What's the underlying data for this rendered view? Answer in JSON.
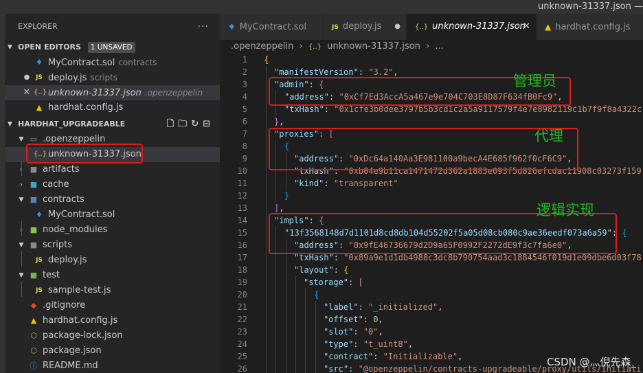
{
  "window": {
    "title": "unknown-31337.json —"
  },
  "sidebar": {
    "title": "EXPLORER",
    "more": "···",
    "open_editors": {
      "label": "OPEN EDITORS",
      "badge": "1 UNSAVED",
      "items": [
        {
          "name": "MyContract.sol",
          "desc": "contracts"
        },
        {
          "name": "deploy.js",
          "desc": "scripts"
        },
        {
          "name": "unknown-31337.json",
          "desc": ".openzeppelin"
        },
        {
          "name": "hardhat.config.js",
          "desc": ""
        }
      ]
    },
    "project": {
      "label": "HARDHAT_UPGRADEABLE",
      "items": [
        {
          "name": ".openzeppelin"
        },
        {
          "name": "unknown-31337.json"
        },
        {
          "name": "artifacts"
        },
        {
          "name": "cache"
        },
        {
          "name": "contracts"
        },
        {
          "name": "MyContract.sol"
        },
        {
          "name": "node_modules"
        },
        {
          "name": "scripts"
        },
        {
          "name": "deploy.js"
        },
        {
          "name": "test"
        },
        {
          "name": "sample-test.js"
        },
        {
          "name": ".gitignore"
        },
        {
          "name": "hardhat.config.js"
        },
        {
          "name": "package-lock.json"
        },
        {
          "name": "package.json"
        },
        {
          "name": "README.md"
        }
      ]
    }
  },
  "tabs": [
    {
      "label": "MyContract.sol"
    },
    {
      "label": "deploy.js"
    },
    {
      "label": "unknown-31337.json"
    },
    {
      "label": "hardhat.config.js"
    }
  ],
  "breadcrumb": {
    "folder": ".openzeppelin",
    "file": "unknown-31337.json",
    "more": "..."
  },
  "code": {
    "line_numbers": [
      "1",
      "2",
      "3",
      "4",
      "5",
      "6",
      "7",
      "8",
      "9",
      "10",
      "11",
      "12",
      "13",
      "14",
      "15",
      "16",
      "17",
      "18",
      "19",
      "20",
      "21",
      "22",
      "23",
      "24",
      "25",
      "26"
    ],
    "manifestVersion_key": "\"manifestVersion\"",
    "manifestVersion_val": "\"3.2\"",
    "admin_key": "\"admin\"",
    "address_key": "\"address\"",
    "admin_address": "\"0xCf7Ed3AccA5a467e9e704C703E8D87F634fB0Fc9\"",
    "txHash_key": "\"txHash\"",
    "admin_txhash": "\"0x1cfe3b0dee3797b5b3cd1c2a5a9117579f4e7e8982119c1b7f9f8a4322c",
    "proxies_key": "\"proxies\"",
    "proxy_address": "\"0xDc64a140Aa3E981100a9becA4E685f962f0cF6C9\"",
    "proxy_txhash": "\"0xb04e9b11ca1471472d362a1883e093f5d826efcdac11908c03273f159",
    "kind_key": "\"kind\"",
    "kind_val": "\"transparent\"",
    "impls_key": "\"impls\"",
    "impl_hash": "\"13f3568148d7d1101d8cd8db104d55202f5a05d08cb080c9ae36eedf073a6a59\"",
    "impl_address": "\"0x9fE46736679d2D9a65F0992F2272dE9f3c7fa6e0\"",
    "impl_txhash": "\"0x89a9e1d1db4988c3dc8b790754aad3c1884546f019d1e09dbe6d03f78",
    "layout_key": "\"layout\"",
    "storage_key": "\"storage\"",
    "label_key": "\"label\"",
    "label_val": "\"_initialized\"",
    "offset_key": "\"offset\"",
    "offset_val": "0",
    "slot_key": "\"slot\"",
    "slot_val": "\"0\"",
    "type_key": "\"type\"",
    "type_val": "\"t_uint8\"",
    "contract_key": "\"contract\"",
    "contract_val": "\"Initializable\"",
    "src_key": "\"src\"",
    "src_val": "\"@openzeppelin/contracts-upgradeable/proxy/utils/Initiali"
  },
  "annotations": {
    "admin": "管理员",
    "proxy": "代理",
    "impl": "逻辑实现"
  },
  "watermark": "CSDN @灬倪先森_",
  "colors": {
    "highlight": "#e01b1b",
    "annotation": "#22bb22",
    "json_key": "#9cdcfe",
    "json_string": "#ce9178"
  }
}
